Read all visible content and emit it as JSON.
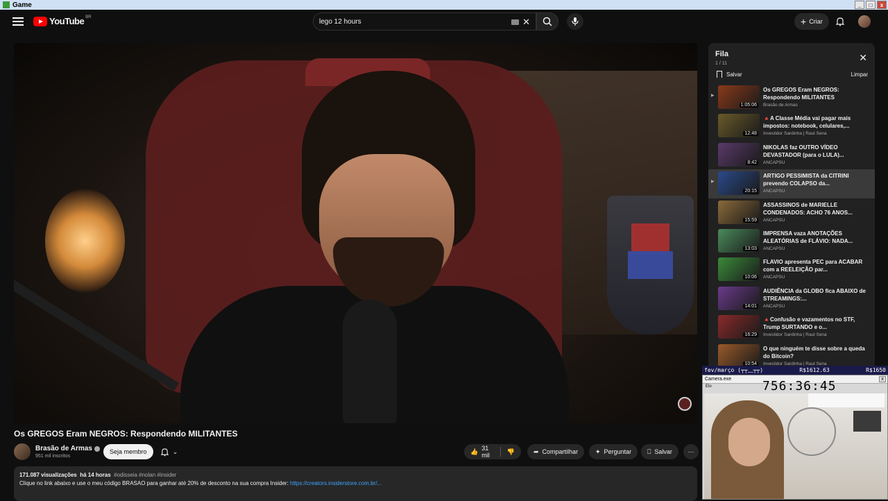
{
  "window": {
    "title": "Game"
  },
  "header": {
    "brand": "YouTube",
    "region": "BR",
    "search_value": "lego 12 hours",
    "create_label": "Criar"
  },
  "video": {
    "title": "Os GREGOS Eram NEGROS: Respondendo MILITANTES",
    "channel": "Brasão de Armas",
    "subscribers": "951 mil inscritos",
    "member_label": "Seja membro",
    "likes": "31 mil",
    "share_label": "Compartilhar",
    "ask_label": "Perguntar",
    "save_label": "Salvar",
    "views": "171.087 visualizações",
    "age": "há 14 horas",
    "tags": "#odisseia #nolan #insider",
    "desc_line": "Clique no link abaixo e use o meu código BRASAO para ganhar até 20% de desconto na sua compra Insider:",
    "desc_link": "https://creators.insiderstore.com.br/..."
  },
  "queue": {
    "title": "Fila",
    "count": "1 / 11",
    "save_label": "Salvar",
    "clear_label": "Limpar",
    "items": [
      {
        "title": "Os GREGOS Eram NEGROS: Respondendo MILITANTES",
        "channel": "Brasão de Armas",
        "duration": "1:05:06",
        "color": "#8a3a1a"
      },
      {
        "title": "🔺A Classe Média vai pagar mais impostos: notebook, celulares,...",
        "channel": "Investidor Sardinha | Raul Sena",
        "duration": "12:48",
        "color": "#6a5a2a"
      },
      {
        "title": "NIKOLAS faz OUTRO VÍDEO DEVASTADOR (para o LULA)...",
        "channel": "ANCAPSU",
        "duration": "8:42",
        "color": "#5a3a6a"
      },
      {
        "title": "ARTIGO PESSIMISTA da CITRINI prevendo COLAPSO da...",
        "channel": "ANCAPSU",
        "duration": "20:15",
        "color": "#2a4a8a"
      },
      {
        "title": "ASSASSINOS de MARIELLE CONDENADOS: ACHO 76 ANOS...",
        "channel": "ANCAPSU",
        "duration": "15:59",
        "color": "#8a6a3a"
      },
      {
        "title": "IMPRENSA vaza ANOTAÇÕES ALEATÓRIAS de FLÁVIO: NADA...",
        "channel": "ANCAPSU",
        "duration": "13:03",
        "color": "#4a8a5a"
      },
      {
        "title": "FLAVIO apresenta PEC para ACABAR com a REELEIÇÃO par...",
        "channel": "ANCAPSU",
        "duration": "10:06",
        "color": "#3a8a3a"
      },
      {
        "title": "AUDIÊNCIA da GLOBO fica ABAIXO de STREAMINGS:...",
        "channel": "ANCAPSU",
        "duration": "14:01",
        "color": "#6a3a8a"
      },
      {
        "title": "🔺Confusão e vazamentos no STF, Trump SURTANDO e o...",
        "channel": "Investidor Sardinha | Raul Sena",
        "duration": "16:29",
        "color": "#8a2a2a"
      },
      {
        "title": "O que ninguém te disse sobre a queda do Bitcoin?",
        "channel": "Investidor Sardinha | Raul Sena",
        "duration": "10:54",
        "color": "#9a5a2a"
      }
    ]
  },
  "overlay": {
    "left": "fev/março (┬┬﹏┬┬)",
    "mid": "R$1612.63",
    "right": "R$1650"
  },
  "camera": {
    "title": "Camera.exe",
    "menu": "Elo",
    "timer": "756:36:45"
  }
}
